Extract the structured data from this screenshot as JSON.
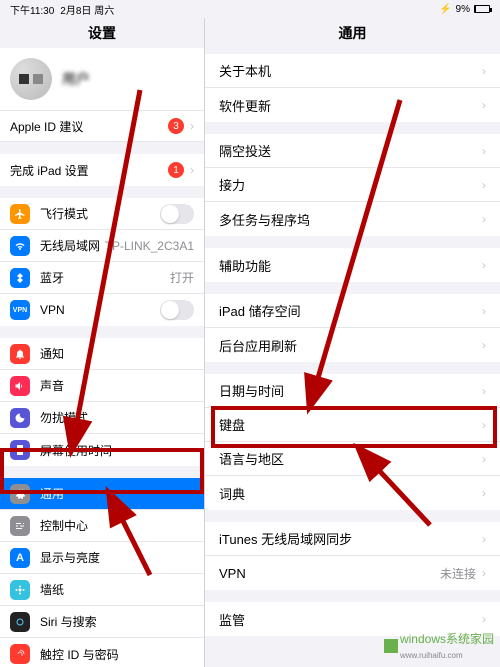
{
  "status": {
    "time": "下午11:30",
    "date": "2月8日 周六",
    "battery_label": "9%",
    "charging_glyph": "⚡"
  },
  "side": {
    "title": "设置",
    "profile": {
      "name": "用户"
    },
    "apple_id": {
      "label": "Apple ID 建议",
      "badge": "3"
    },
    "finish_setup": {
      "label": "完成 iPad 设置",
      "badge": "1"
    },
    "airplane": "飞行模式",
    "wifi": {
      "label": "无线局域网",
      "value": "TP-LINK_2C3A1"
    },
    "bluetooth": {
      "label": "蓝牙",
      "value": "打开"
    },
    "vpn": "VPN",
    "notifications": "通知",
    "sounds": "声音",
    "dnd": "勿扰模式",
    "screentime": "屏幕使用时间",
    "general": "通用",
    "control": "控制中心",
    "display": "显示与亮度",
    "wallpaper": "墙纸",
    "siri": "Siri 与搜索",
    "touchid": "触控 ID 与密码"
  },
  "main": {
    "title": "通用",
    "about": "关于本机",
    "update": "软件更新",
    "airdrop": "隔空投送",
    "handoff": "接力",
    "multitask": "多任务与程序坞",
    "accessibility": "辅助功能",
    "storage": "iPad 储存空间",
    "bgrefresh": "后台应用刷新",
    "datetime": "日期与时间",
    "keyboard": "键盘",
    "lang": "语言与地区",
    "dict": "词典",
    "itunes": "iTunes 无线局域网同步",
    "vpn": {
      "label": "VPN",
      "value": "未连接"
    },
    "profiles": "监管"
  },
  "watermark": {
    "text": "windows系统家园",
    "url": "www.ruihaifu.com"
  },
  "colors": {
    "accent": "#007aff",
    "badge": "#ff3b30",
    "annotation": "#b00000"
  }
}
